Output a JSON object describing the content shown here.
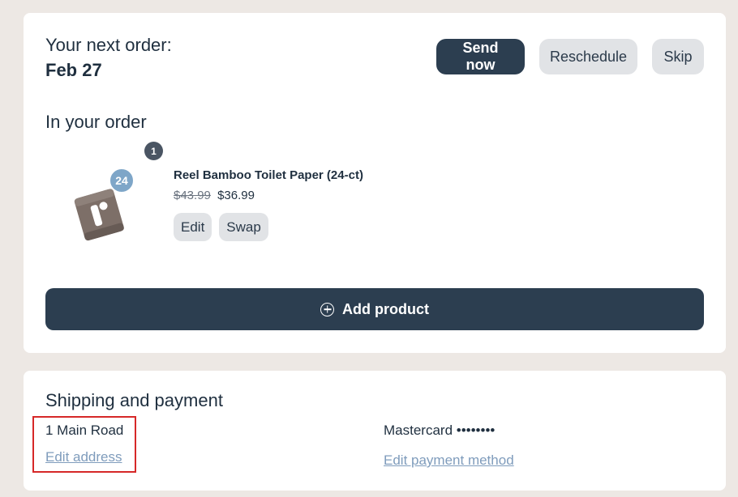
{
  "order": {
    "title_line1": "Your next order:",
    "date": "Feb 27",
    "send_now_label": "Send now",
    "reschedule_label": "Reschedule",
    "skip_label": "Skip",
    "section_title": "In your order",
    "items": [
      {
        "count_badge": "1",
        "quantity": "24",
        "name": "Reel Bamboo Toilet Paper (24-ct)",
        "old_price": "$43.99",
        "new_price": "$36.99",
        "edit_label": "Edit",
        "swap_label": "Swap"
      }
    ],
    "add_product_label": "Add product"
  },
  "shipping": {
    "section_title": "Shipping and payment",
    "address": "1 Main Road",
    "edit_address_label": "Edit address",
    "payment": "Mastercard ••••••••",
    "edit_payment_label": "Edit payment method"
  },
  "colors": {
    "primary": "#2c3e50",
    "secondary_button": "#e1e3e6",
    "link": "#7f9cbc",
    "highlight_box": "#d62828",
    "background": "#ede8e4"
  }
}
